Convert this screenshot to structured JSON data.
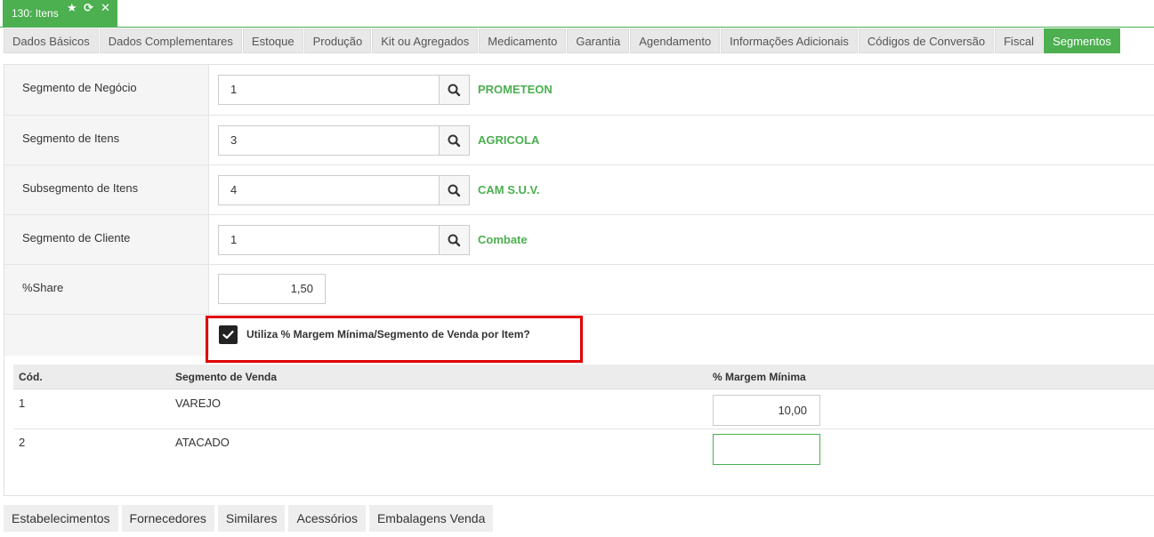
{
  "window_tab": {
    "title": "130: Itens",
    "icons": [
      "star-icon",
      "refresh-icon",
      "close-icon"
    ]
  },
  "tabs": [
    {
      "label": "Dados Básicos",
      "active": false
    },
    {
      "label": "Dados Complementares",
      "active": false
    },
    {
      "label": "Estoque",
      "active": false
    },
    {
      "label": "Produção",
      "active": false
    },
    {
      "label": "Kit ou Agregados",
      "active": false
    },
    {
      "label": "Medicamento",
      "active": false
    },
    {
      "label": "Garantia",
      "active": false
    },
    {
      "label": "Agendamento",
      "active": false
    },
    {
      "label": "Informações Adicionais",
      "active": false
    },
    {
      "label": "Códigos de Conversão",
      "active": false
    },
    {
      "label": "Fiscal",
      "active": false
    },
    {
      "label": "Segmentos",
      "active": true
    }
  ],
  "form": {
    "segmento_negocio": {
      "label": "Segmento de Negócio",
      "value": "1",
      "description": "PROMETEON"
    },
    "segmento_itens": {
      "label": "Segmento de Itens",
      "value": "3",
      "description": "AGRICOLA"
    },
    "subsegmento_itens": {
      "label": "Subsegmento de Itens",
      "value": "4",
      "description": "CAM S.U.V."
    },
    "segmento_cliente": {
      "label": "Segmento de Cliente",
      "value": "1",
      "description": "Combate"
    },
    "share": {
      "label": "%Share",
      "value": "1,50"
    },
    "checkbox": {
      "label": "Utiliza % Margem Mínima/Segmento de Venda por Item?",
      "checked": true
    }
  },
  "grid": {
    "headers": {
      "cod": "Cód.",
      "segmento": "Segmento de Venda",
      "margem": "% Margem Mínima"
    },
    "rows": [
      {
        "cod": "1",
        "segmento": "VAREJO",
        "margem": "10,00"
      },
      {
        "cod": "2",
        "segmento": "ATACADO",
        "margem": ""
      }
    ]
  },
  "bottom_tabs": [
    "Estabelecimentos",
    "Fornecedores",
    "Similares",
    "Acessórios",
    "Embalagens Venda"
  ],
  "colors": {
    "accent": "#4caf50",
    "highlight": "#e00000"
  }
}
